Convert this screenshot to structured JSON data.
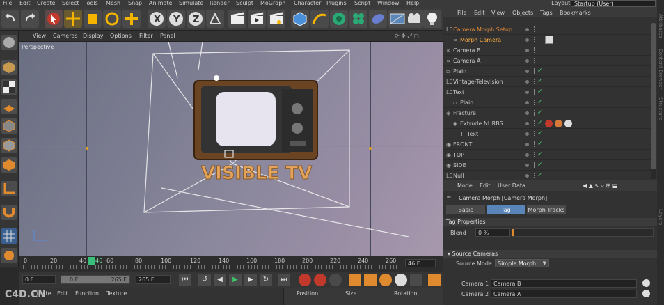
{
  "menubar": {
    "items": [
      "File",
      "Edit",
      "Create",
      "Select",
      "Tools",
      "Mesh",
      "Snap",
      "Animate",
      "Simulate",
      "Render",
      "Sculpt",
      "MoGraph",
      "Character",
      "Plugins",
      "Script",
      "Window",
      "Help"
    ],
    "layout_label": "Layout:",
    "layout_value": "Startup (User)"
  },
  "viewport": {
    "menu": [
      "View",
      "Cameras",
      "Display",
      "Options",
      "Filter",
      "Panel"
    ],
    "label": "Perspective",
    "scene_text": "VISIBLE TV"
  },
  "timeline": {
    "ticks": [
      "0",
      "20",
      "40",
      "60",
      "80",
      "100",
      "120",
      "140",
      "160",
      "180",
      "200",
      "220",
      "240",
      "260"
    ],
    "current": "46",
    "end_field": "46 F"
  },
  "transport": {
    "start": "0 F",
    "field2": "0 F",
    "field3": "265 F",
    "field4": "265 F"
  },
  "bottom": {
    "menu": [
      "Create",
      "Edit",
      "Function",
      "Texture"
    ],
    "columns": [
      "Position",
      "Size",
      "Rotation"
    ],
    "watermark": "C4D.CN"
  },
  "objmgr": {
    "menu": [
      "File",
      "Edit",
      "View",
      "Objects",
      "Tags",
      "Bookmarks"
    ],
    "rows": [
      {
        "name": "Camera Morph Setup",
        "color": "#e08a3a"
      },
      {
        "name": "Morph Camera",
        "color": "#ffb040"
      },
      {
        "name": "Camera B",
        "color": "#c8c8c8"
      },
      {
        "name": "Camera A",
        "color": "#c8c8c8"
      },
      {
        "name": "Plain",
        "color": "#c8c8c8"
      },
      {
        "name": "Vintage-Television",
        "color": "#c8c8c8"
      },
      {
        "name": "Text",
        "color": "#c8c8c8"
      },
      {
        "name": "Plain",
        "color": "#c8c8c8"
      },
      {
        "name": "Fracture",
        "color": "#c8c8c8"
      },
      {
        "name": "Extrude NURBS",
        "color": "#c8c8c8"
      },
      {
        "name": "Text",
        "color": "#c8c8c8"
      },
      {
        "name": "FRONT",
        "color": "#c8c8c8"
      },
      {
        "name": "TOP",
        "color": "#c8c8c8"
      },
      {
        "name": "SIDE",
        "color": "#c8c8c8"
      },
      {
        "name": "Null",
        "color": "#c8c8c8"
      }
    ]
  },
  "attr": {
    "menu": [
      "Mode",
      "Edit",
      "User Data"
    ],
    "title": "Camera Morph [Camera Morph]",
    "tabs": [
      "Basic",
      "Tag",
      "Morph Tracks"
    ],
    "active_tab": "Tag",
    "tag_properties": "Tag Properties",
    "blend_label": "Blend",
    "blend_value": "0 %",
    "source_cameras": "Source Cameras",
    "source_mode_label": "Source Mode",
    "source_mode_value": "Simple Morph",
    "camera1_label": "Camera 1",
    "camera1_value": "Camera B",
    "camera2_label": "Camera 2",
    "camera2_value": "Camera A"
  },
  "rightstrip": [
    "Attributes",
    "Content Browser",
    "Structure",
    "Layers"
  ]
}
